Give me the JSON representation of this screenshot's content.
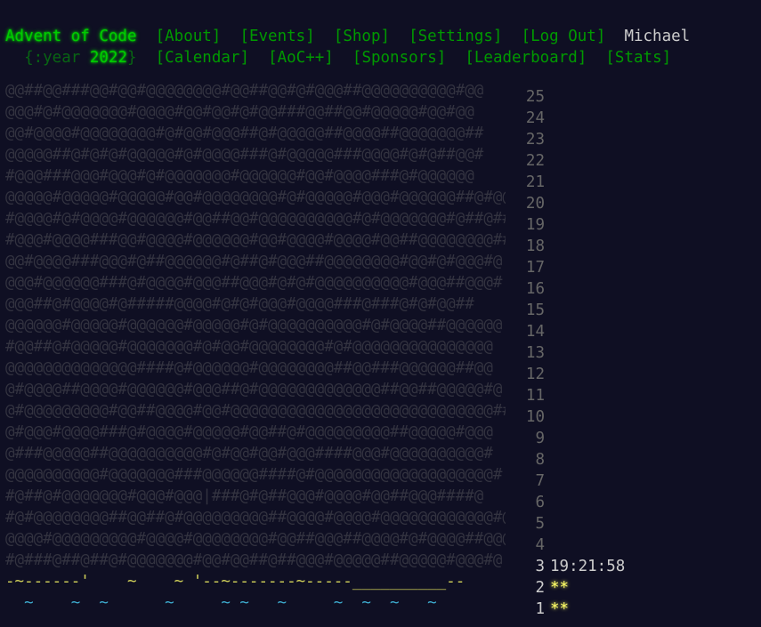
{
  "header": {
    "title": "Advent of Code",
    "year_prefix": "{:year ",
    "year": "2022",
    "year_suffix": "}",
    "nav_row1": [
      "[About]",
      "[Events]",
      "[Shop]",
      "[Settings]",
      "[Log Out]"
    ],
    "user": "Michael",
    "nav_row2": [
      "[Calendar]",
      "[AoC++]",
      "[Sponsors]",
      "[Leaderboard]",
      "[Stats]"
    ]
  },
  "calendar": {
    "rows": [
      {
        "day": "25",
        "art": "@@##@@###@@#@@#@@@@@@@@#@@##@@#@#@@@##@@@@@@@@@@#@@",
        "extra": "",
        "stars": ""
      },
      {
        "day": "24",
        "art": "@@@#@#@@@@@@@#@@@@#@@#@@#@#@@###@@##@@#@@@@@#@@#@@",
        "extra": "",
        "stars": ""
      },
      {
        "day": "23",
        "art": "@@#@@@@#@@@@@@@@#@#@@#@@@##@#@@@@@##@@@@##@@@@@@@##",
        "extra": "",
        "stars": ""
      },
      {
        "day": "22",
        "art": "@@@@@##@#@#@#@@@@@#@#@@@@###@#@@@@@###@@@@#@#@##@@#",
        "extra": "",
        "stars": ""
      },
      {
        "day": "21",
        "art": "#@@@###@@@#@@@#@#@@@@@@@#@@@@@@#@@#@@@@###@#@@@@@@",
        "extra": "",
        "stars": ""
      },
      {
        "day": "20",
        "art": "@@@@@#@@@@@#@@@@@#@@#@@@@@@@@#@#@@@@@#@@@#@@@@@@##@#@@#",
        "extra": "",
        "stars": ""
      },
      {
        "day": "19",
        "art": "#@@@@#@#@@@@#@@@@@@#@@##@@#@@@@@@@@@@#@#@@@@@@@#@##@##",
        "extra": "",
        "stars": ""
      },
      {
        "day": "18",
        "art": "#@@@#@@@@###@@#@@@@#@@@@@@#@@#@@@@#@@@@#@@##@@@@@@@@##@#",
        "extra": "",
        "stars": ""
      },
      {
        "day": "17",
        "art": "@@#@@@@###@@@#@##@@@@@@#@##@#@@@##@@@@@@@@#@@#@#@@@#@",
        "extra": "",
        "stars": ""
      },
      {
        "day": "16",
        "art": "@@@#@@@@@@###@#@@@@#@@@##@@@#@#@#@@@@@@@@@@#@@@##@@@#",
        "extra": "",
        "stars": ""
      },
      {
        "day": "15",
        "art": "@@@##@#@@@@#@#####@@@@#@#@#@@@#@@@@###@###@#@#@@##",
        "extra": "",
        "stars": ""
      },
      {
        "day": "14",
        "art": "@@@@@@#@@@@@#@@@@@@#@@@@@#@#@@@@@@@@@@#@#@@@@##@@@@@@",
        "extra": "",
        "stars": ""
      },
      {
        "day": "13",
        "art": "#@@##@#@@@@@#@@@@@@@#@#@@#@@@@@@@@#@#@@@@@@@@@@@@@@@",
        "extra": "",
        "stars": ""
      },
      {
        "day": "12",
        "art": "@@@@@@@@@@@@@@####@#@@@@@@#@@@@@@@@##@@###@@@@@@##@@",
        "extra": "",
        "stars": ""
      },
      {
        "day": "11",
        "art": "@#@@@@##@@@@#@@@@@@#@@@##@#@@@@@@@@@@@@@##@@##@@@@@#@",
        "extra": "",
        "stars": ""
      },
      {
        "day": "10",
        "art": "@#@@@@@@@@@#@@##@@@@#@@#@@@@@@@@@@@@@@@@@@@@@@@@@@@@##@",
        "extra": "",
        "stars": ""
      },
      {
        "day": "9",
        "art": "@#@@@#@@@@###@#@@@@#@@@@@#@@##@#@@@@@@@@@##@@@@@#@@@",
        "extra": "",
        "stars": ""
      },
      {
        "day": "8",
        "art": "@###@@@@@##@@@@@@@@@@#@#@@#@@#@@@####@@@#@@@@@@@@@@#",
        "extra": "",
        "stars": ""
      },
      {
        "day": "7",
        "art": "@@@@@@@@@@#@@@@@@@###@@@@@@####@#@@@@@@@@@@@@@@@@@@@#",
        "extra": "",
        "stars": ""
      },
      {
        "day": "6",
        "art": "#@##@#@@@@@@@#@@@#@@@|###@#@##@@@#@@@@#@@##@@@####@",
        "extra": "",
        "stars": ""
      },
      {
        "day": "5",
        "art": "#@#@@@@@@@@##@@##@#@@@@@@@@@##@@@@#@@@@#@@@@@@@@@@@@#@@",
        "extra": "",
        "stars": ""
      },
      {
        "day": "4",
        "art": "@@@@#@@@@@@@@@#@@@@#@@@@@@@@#@@##@@@##@@@@#@#@@@@##@@@#",
        "extra": "",
        "stars": ""
      },
      {
        "day": "3",
        "art": "#@###@##@##@#@@@@@@@#@@#@@##@##@@@#@@@@@##@@@@@#@@@#@",
        "extra": "19:21:58",
        "stars": ""
      },
      {
        "day": "2",
        "art": "-~------'    ~    ~ '--~-------~-----__________--",
        "extra": "",
        "stars": "**"
      },
      {
        "day": "1",
        "art": "  ~    ~  ~      ~     ~ ~   ~     ~  ~  ~   ~",
        "extra": "",
        "stars": "**"
      }
    ]
  }
}
